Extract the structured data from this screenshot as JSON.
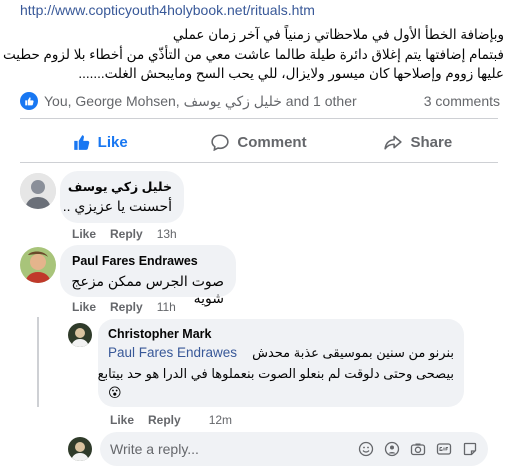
{
  "post": {
    "link": "http://www.copticyouth4holybook.net/rituals.htm",
    "lines": [
      "وبإضافة الخطأ الأول في ملاحظاتي زمنياً في آخر زمان عملي",
      "فبتمام إضافتها يتم إغلاق دائرة طيلة طالما عاشت معي من التأذّي من أخطاء بلا لزوم حطيت",
      "عليها زووم وإصلاحها كان ميسور ولايزال، للي يحب السح ومايبحش الغلت......."
    ]
  },
  "reactions": {
    "names": "You, George Mohsen, خليل زكي يوسف and 1 other",
    "comments_count": "3 comments"
  },
  "actions": {
    "like": "Like",
    "comment": "Comment",
    "share": "Share"
  },
  "comments": [
    {
      "name": "خليل زكي يوسف",
      "text": "أحسنت يا عزيزي ..",
      "like": "Like",
      "reply": "Reply",
      "time": "13h"
    },
    {
      "name": "Paul Fares Endrawes",
      "text": "صوت الجرس ممكن مزعج شويه",
      "like": "Like",
      "reply": "Reply",
      "time": "11h"
    }
  ],
  "reply": {
    "name": "Christopher Mark",
    "mention": "Paul Fares Endrawes",
    "line1": "بنرنو من سنين بموسيقى عذبة محدش",
    "line2": "بيصحى وحتى دلوقت لم بنعلو الصوت بنعملوها في الدرا هو حد بيتابع",
    "emoji": "😮",
    "like": "Like",
    "reply": "Reply",
    "time": "12m"
  },
  "reply_box": {
    "placeholder": "Write a reply..."
  },
  "colors": {
    "accent": "#1877f2",
    "link": "#385898",
    "muted": "#65676b",
    "bubble": "#f0f2f5"
  }
}
